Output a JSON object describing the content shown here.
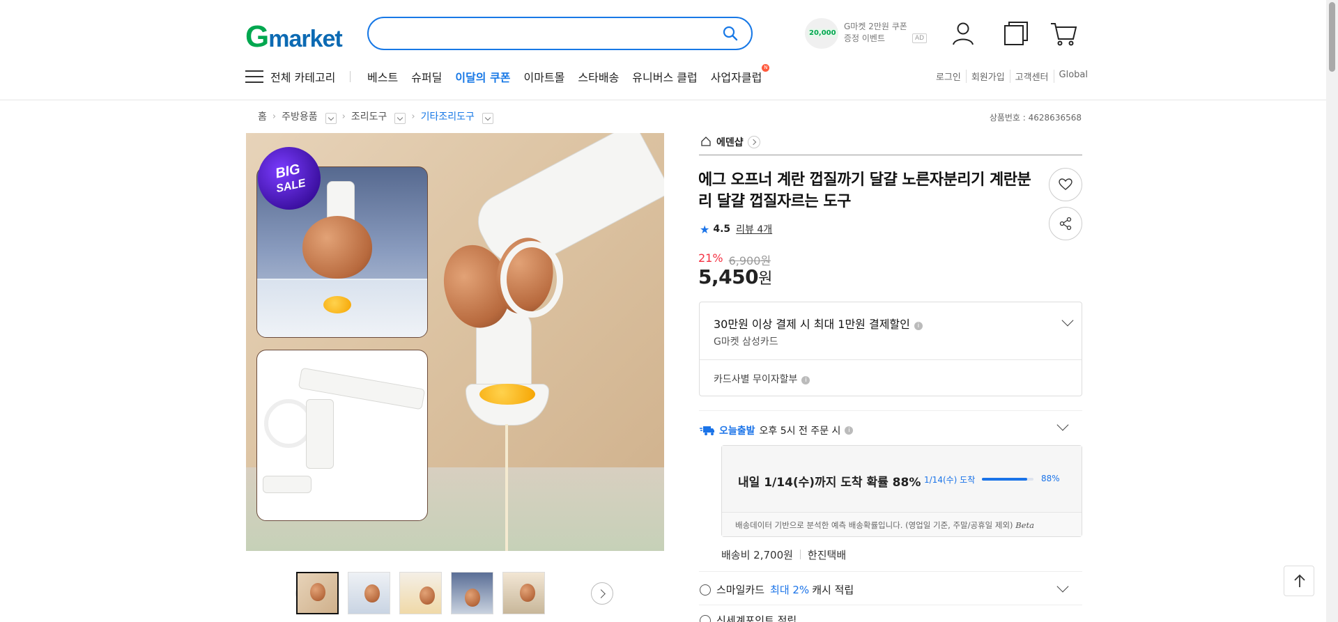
{
  "header": {
    "logo_g": "G",
    "logo_rest": "market",
    "search": {
      "placeholder": "",
      "value": ""
    },
    "ad_coupon": {
      "amount": "20,000",
      "line1": "G마켓 2만원 쿠폰",
      "line2": "증정 이벤트",
      "ad_label": "AD"
    },
    "icons": [
      "user-icon",
      "recent-items-icon",
      "cart-icon"
    ]
  },
  "nav": {
    "all_categories": "전체 카테고리",
    "links": [
      "베스트",
      "슈퍼딜",
      "이달의 쿠폰",
      "이마트몰",
      "스타배송",
      "유니버스 클럽",
      "사업자클럽"
    ],
    "highlight_index": 2,
    "util": [
      "로그인",
      "회원가입",
      "고객센터",
      "Global"
    ]
  },
  "breadcrumb": {
    "items": [
      "홈",
      "주방용품",
      "조리도구",
      "기타조리도구"
    ]
  },
  "product_no": "상품번호 : 4628636568",
  "main_image": {
    "badge_line1": "BIG",
    "badge_line2": "SALE"
  },
  "thumbnails": {
    "count": 5,
    "selected": 0
  },
  "product": {
    "shop_name": "에덴샵",
    "title": "에그 오프너 계란 껍질까기 달걀 노른자분리기 계란분리 달걀 껍질자르는 도구",
    "rating": "4.5",
    "review_label": "리뷰 4개",
    "discount": "21%",
    "original_price": "6,900원",
    "price": "5,450",
    "price_unit": "원"
  },
  "card_offer": {
    "title": "30만원 이상 결제 시 최대 1만원 결제할인",
    "card": "G마켓 삼성카드",
    "installment": "카드사별 무이자할부"
  },
  "delivery": {
    "today_tag": "오늘출발",
    "cutoff": "오후 5시 전 주문 시",
    "probability_title": "내일 1/14(수)까지 도착 확률 88%",
    "arrival_label": "1/14(수) 도착",
    "probability": 0.88,
    "probability_text": "88%",
    "note": "배송데이터 기반으로 분석한 예측 배송확률입니다. (영업일 기준, 주말/공휴일 제외)",
    "beta": "Beta",
    "fee": "배송비 2,700원",
    "carrier": "한진택배"
  },
  "benefits": {
    "smile_prefix": "스마일카드",
    "smile_highlight": "최대 2%",
    "smile_suffix": "캐시 적립",
    "shinsegae": "신세계포인트 적립"
  },
  "colors": {
    "brand_green": "#00a74f",
    "brand_blue": "#0c6ab3",
    "accent_blue": "#1778e6",
    "discount_red": "#f43142"
  }
}
